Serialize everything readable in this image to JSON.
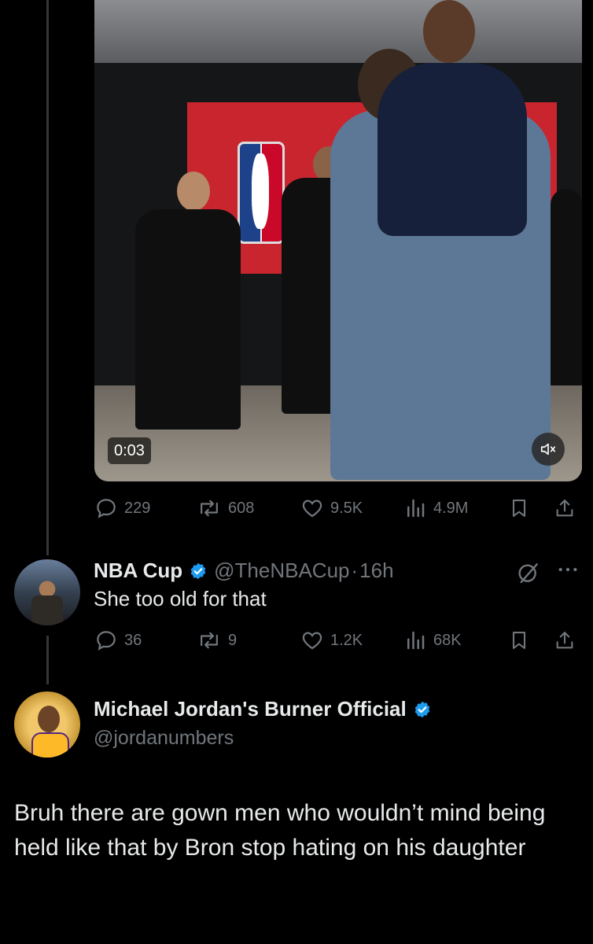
{
  "video": {
    "duration": "0:03"
  },
  "tweet1_actions": {
    "replies": "229",
    "reposts": "608",
    "likes": "9.5K",
    "views": "4.9M"
  },
  "reply": {
    "name": "NBA Cup",
    "handle": "@TheNBACup",
    "separator": "·",
    "time": "16h",
    "text": "She too old for that",
    "replies": "36",
    "reposts": "9",
    "likes": "1.2K",
    "views": "68K"
  },
  "main_post": {
    "name": "Michael Jordan's Burner Official",
    "handle": "@jordanumbers",
    "text": "Bruh there are gown men who wouldn’t mind being held like that by Bron stop hating on his daughter"
  },
  "colors": {
    "background": "#000000",
    "text": "#e7e9ea",
    "muted": "#71767b",
    "verified": "#1d9bf0"
  }
}
